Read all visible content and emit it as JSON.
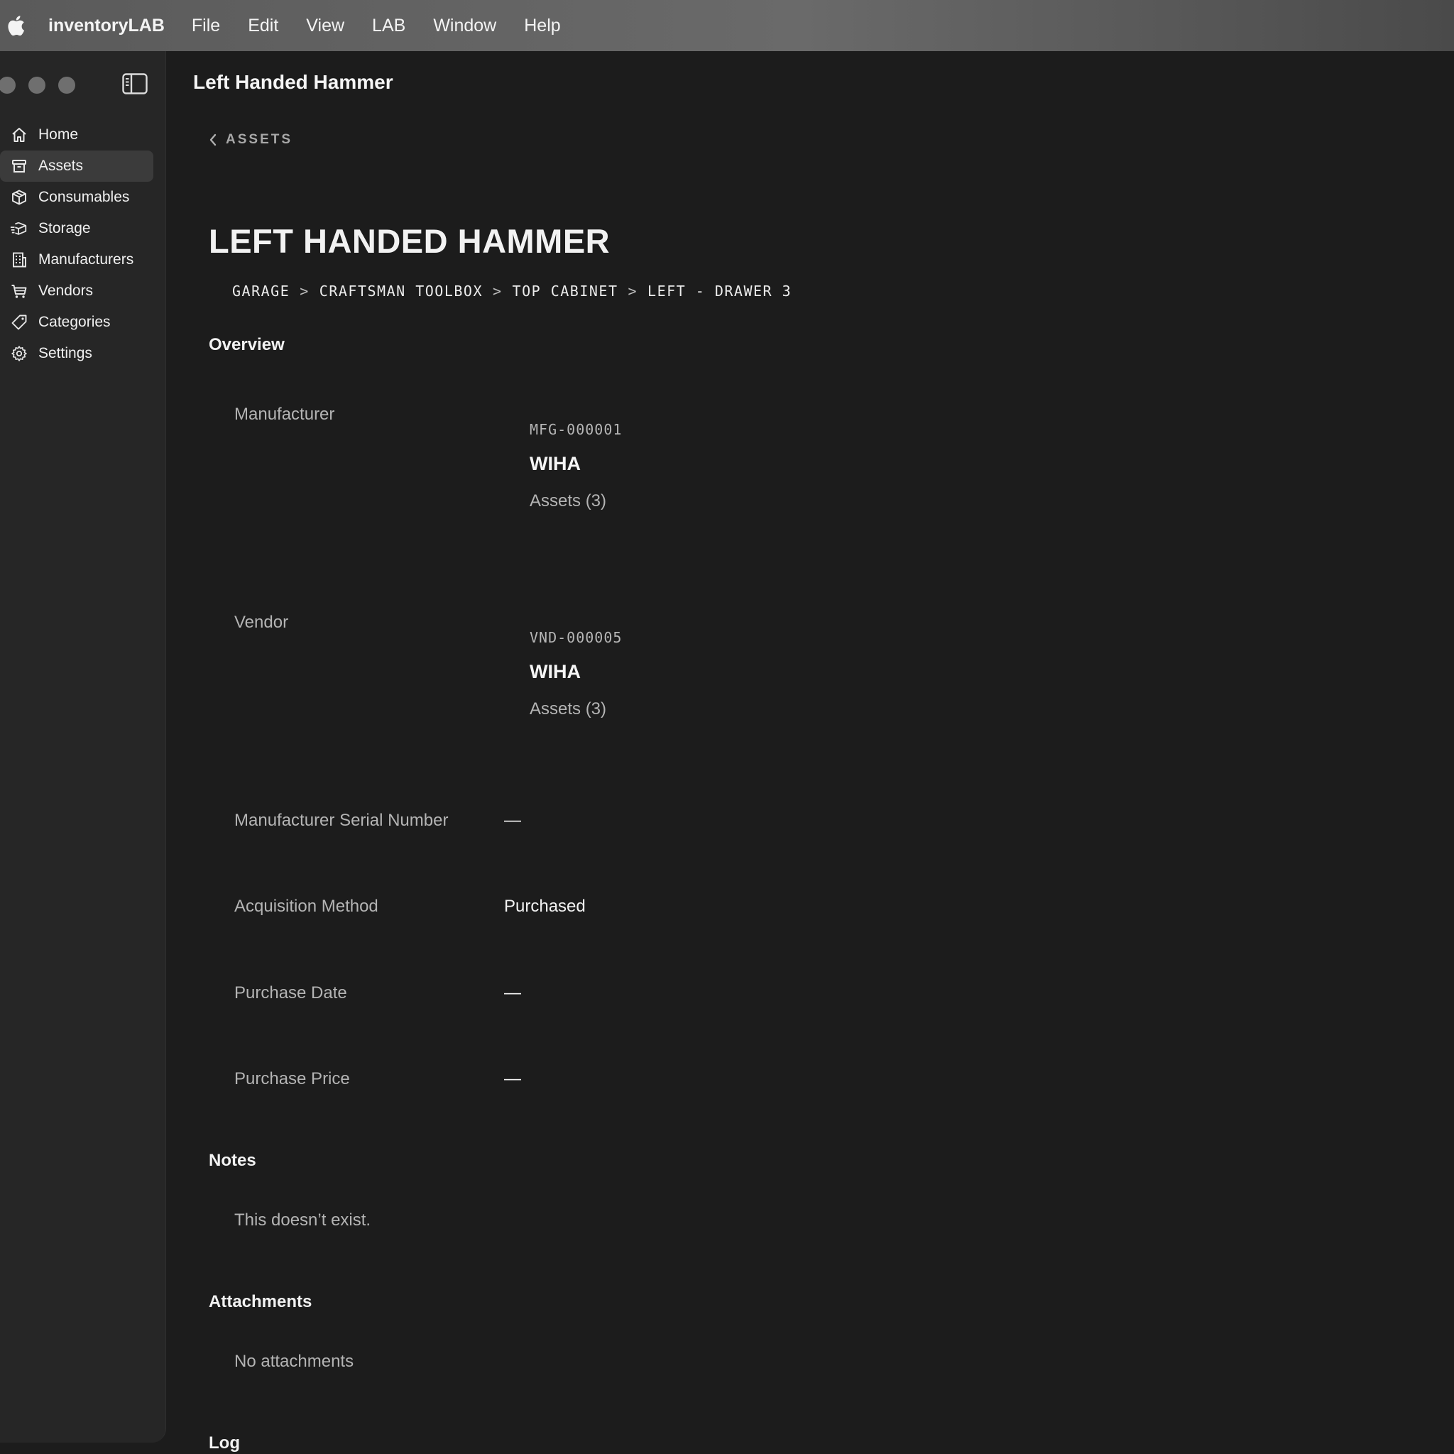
{
  "menubar": {
    "app_name": "inventoryLAB",
    "items": [
      "File",
      "Edit",
      "View",
      "LAB",
      "Window",
      "Help"
    ]
  },
  "window": {
    "title": "Left Handed Hammer"
  },
  "sidebar": {
    "items": [
      {
        "label": "Home",
        "icon": "house-icon"
      },
      {
        "label": "Assets",
        "icon": "archive-box-icon",
        "active": true
      },
      {
        "label": "Consumables",
        "icon": "cube-icon"
      },
      {
        "label": "Storage",
        "icon": "package-stack-icon"
      },
      {
        "label": "Manufacturers",
        "icon": "building-icon"
      },
      {
        "label": "Vendors",
        "icon": "cart-icon"
      },
      {
        "label": "Categories",
        "icon": "tag-icon"
      },
      {
        "label": "Settings",
        "icon": "gear-icon"
      }
    ]
  },
  "page": {
    "back_label": "ASSETS",
    "title": "LEFT HANDED HAMMER",
    "location": [
      "GARAGE",
      "CRAFTSMAN TOOLBOX",
      "TOP CABINET",
      "LEFT - DRAWER 3"
    ],
    "location_separator": ">"
  },
  "overview": {
    "heading": "Overview",
    "manufacturer": {
      "label": "Manufacturer",
      "code": "MFG-000001",
      "name": "WIHA",
      "assets": "Assets (3)"
    },
    "vendor": {
      "label": "Vendor",
      "code": "VND-000005",
      "name": "WIHA",
      "assets": "Assets (3)"
    },
    "serial": {
      "label": "Manufacturer Serial Number",
      "value": "—"
    },
    "acquisition": {
      "label": "Acquisition Method",
      "value": "Purchased"
    },
    "purchase_date": {
      "label": "Purchase Date",
      "value": "—"
    },
    "purchase_price": {
      "label": "Purchase Price",
      "value": "—"
    }
  },
  "notes": {
    "heading": "Notes",
    "text": "This doesn’t exist."
  },
  "attachments": {
    "heading": "Attachments",
    "empty_text": "No attachments"
  },
  "log": {
    "heading": "Log"
  },
  "colors": {
    "background": "#1c1c1c",
    "sidebar": "#262626",
    "selection": "#3b3b3b",
    "menubar": "#5e5e5e"
  }
}
